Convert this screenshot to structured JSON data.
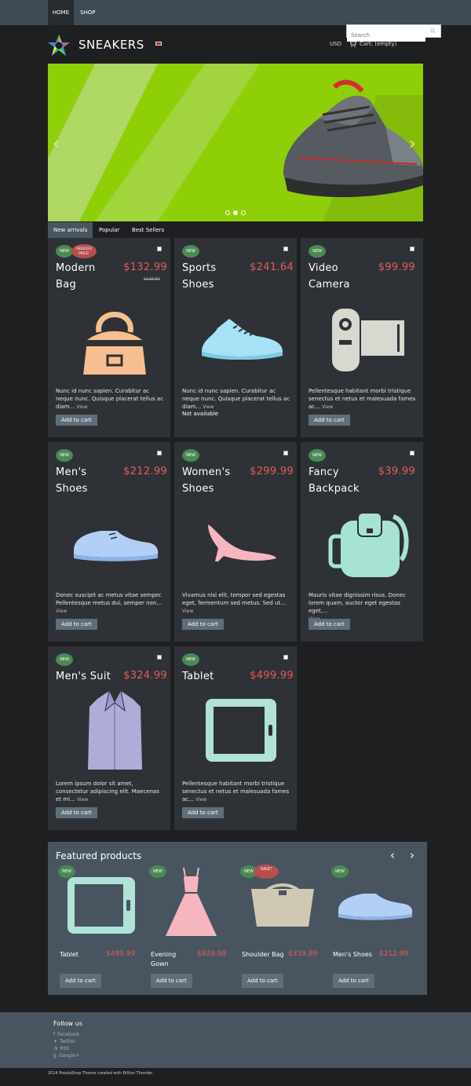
{
  "nav": {
    "home": "HOME",
    "shop": "SHOP"
  },
  "search": {
    "placeholder": "Search"
  },
  "brand": {
    "name": "SNEAKERS"
  },
  "header": {
    "currency": "USD",
    "cart": "Cart: (empty)"
  },
  "tabs": [
    "New arrivals",
    "Popular",
    "Best Sellers"
  ],
  "products": [
    {
      "name": "Modern Bag",
      "price": "$132.99",
      "old_price": "$139.99",
      "badge": "NEW",
      "badge2": "REDUCED PRICE!",
      "desc": "Nunc id nunc sapien. Curabitur ac neque nunc. Quisque placerat tellus ac diam...",
      "view": "View",
      "button": "Add to cart"
    },
    {
      "name": "Sports Shoes",
      "price": "$241.64",
      "badge": "NEW",
      "desc": "Nunc id nunc sapien. Curabitur ac neque nunc. Quisque placerat tellus ac diam...",
      "view": "View",
      "availability": "Not available",
      "button": "Add to cart"
    },
    {
      "name": "Video Camera",
      "price": "$99.99",
      "badge": "NEW",
      "desc": "Pellentesque habitant morbi tristique senectus et netus et malesuada fames ac...",
      "view": "View",
      "button": "Add to cart"
    },
    {
      "name": "Men's Shoes",
      "price": "$212.99",
      "badge": "NEW",
      "desc": "Donec suscipit ac metus vitae semper. Pellentesque metus dui, semper non...",
      "view": "View",
      "button": "Add to cart"
    },
    {
      "name": "Women's Shoes",
      "price": "$299.99",
      "badge": "NEW",
      "desc": "Vivamus nisi elit, tempor sed egestas eget, fermentum sed metus. Sed ut...",
      "view": "View",
      "button": "Add to cart"
    },
    {
      "name": "Fancy Backpack",
      "price": "$39.99",
      "badge": "NEW",
      "desc": "Mauris vitae dignissim risus. Donec lorem quam, auctor eget egestas eget,...",
      "view": "View",
      "button": "Add to cart"
    },
    {
      "name": "Men's Suit",
      "price": "$324.99",
      "badge": "NEW",
      "desc": "Lorem ipsum dolor sit amet, consectetur adipiscing elit. Maecenas et mi...",
      "view": "View",
      "button": "Add to cart"
    },
    {
      "name": "Tablet",
      "price": "$499.99",
      "badge": "NEW",
      "desc": "Pellentesque habitant morbi tristique senectus et netus et malesuada fames ac...",
      "view": "View",
      "button": "Add to cart"
    }
  ],
  "featured": {
    "title": "Featured products",
    "items": [
      {
        "name": "Tablet",
        "price": "$499.99",
        "badge": "NEW",
        "button": "Add to cart"
      },
      {
        "name": "Evening Gown",
        "price": "$929.99",
        "badge": "NEW",
        "button": "Add to cart"
      },
      {
        "name": "Shoulder Bag",
        "price": "$339.99",
        "badge": "NEW",
        "badge2": "SALE!",
        "button": "Add to cart"
      },
      {
        "name": "Men's Shoes",
        "price": "$212.99",
        "badge": "NEW",
        "button": "Add to cart"
      }
    ]
  },
  "footer": {
    "title": "Follow us",
    "links": [
      "Facebook",
      "Twitter",
      "RSS",
      "Google+"
    ],
    "copyright": "2014 PrestaShop Theme created with Billion Themler."
  },
  "colors": {
    "accent_price": "#e55b58",
    "hero_green": "#8fcf07",
    "badge_new": "#4a8a55",
    "badge_sale": "#b74e4e"
  }
}
